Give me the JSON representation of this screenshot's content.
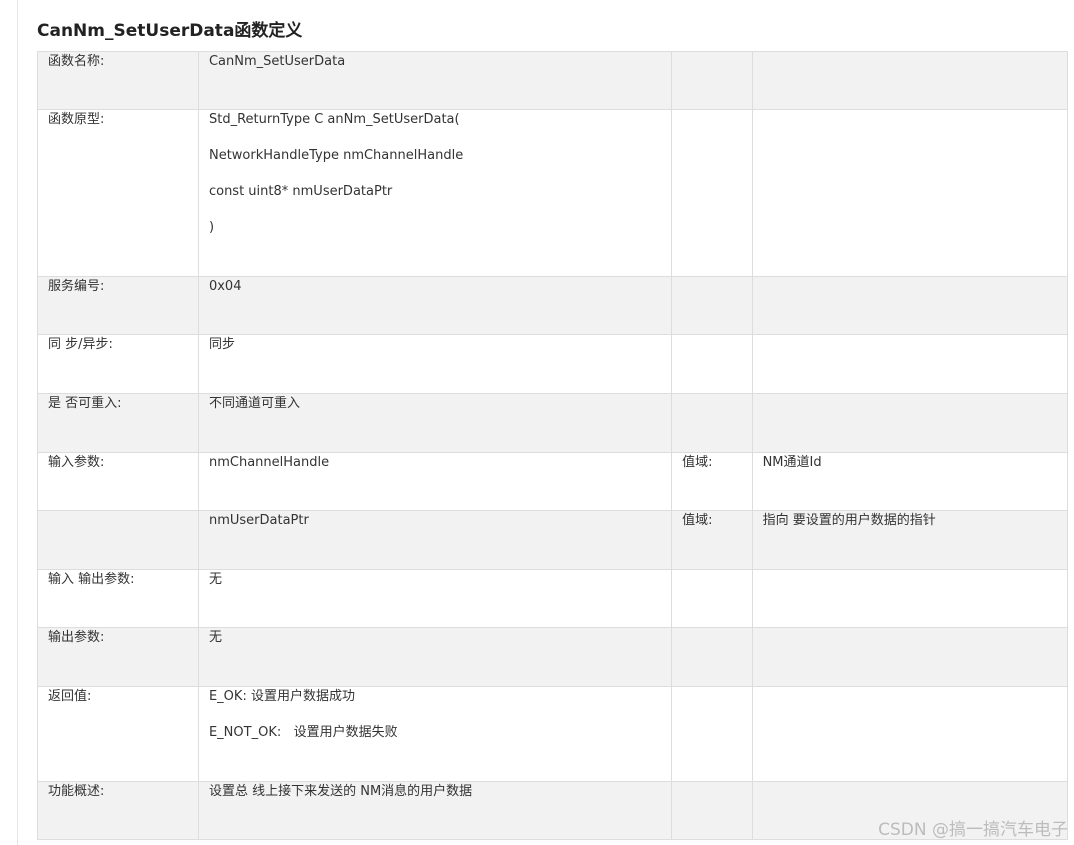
{
  "title": "CanNm_SetUserData函数定义",
  "rows": [
    {
      "label": "函数名称:",
      "value": [
        "CanNm_SetUserData"
      ],
      "c3": "",
      "c4": ""
    },
    {
      "label": "函数原型:",
      "value": [
        "Std_ReturnType C anNm_SetUserData(",
        "NetworkHandleType nmChannelHandle",
        "const uint8* nmUserDataPtr",
        ")"
      ],
      "c3": "",
      "c4": ""
    },
    {
      "label": "服务编号:",
      "value": [
        "0x04"
      ],
      "c3": "",
      "c4": ""
    },
    {
      "label": "同 步/异步:",
      "value": [
        "同步"
      ],
      "c3": "",
      "c4": ""
    },
    {
      "label": "是 否可重入:",
      "value": [
        "不同通道可重入"
      ],
      "c3": "",
      "c4": ""
    },
    {
      "label": "输入参数:",
      "value": [
        "nmChannelHandle"
      ],
      "c3": "值域:",
      "c4": "NM通道Id"
    },
    {
      "label": "",
      "value": [
        "nmUserDataPtr"
      ],
      "c3": "值域:",
      "c4": "指向 要设置的用户数据的指针"
    },
    {
      "label": "输入 输出参数:",
      "value": [
        "无"
      ],
      "c3": "",
      "c4": ""
    },
    {
      "label": "输出参数:",
      "value": [
        "无"
      ],
      "c3": "",
      "c4": ""
    },
    {
      "label": "返回值:",
      "value": [
        "E_OK: 设置用户数据成功",
        "E_NOT_OK:   设置用户数据失败"
      ],
      "c3": "",
      "c4": ""
    },
    {
      "label": "功能概述:",
      "value": [
        "设置总 线上接下来发送的 NM消息的用户数据"
      ],
      "c3": "",
      "c4": ""
    }
  ],
  "watermark": "CSDN @搞一搞汽车电子"
}
